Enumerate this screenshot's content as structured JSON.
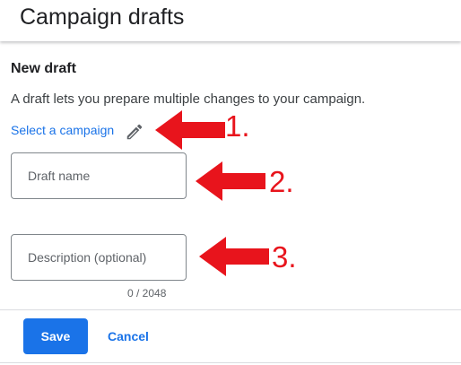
{
  "header": {
    "title": "Campaign drafts"
  },
  "form": {
    "section_title": "New draft",
    "description": "A draft lets you prepare multiple changes to your campaign.",
    "select_campaign_label": "Select a campaign",
    "select_campaign_icon": "pencil-icon",
    "draft_name_placeholder": "Draft name",
    "draft_name_value": "",
    "description_placeholder": "Description (optional)",
    "description_value": "",
    "char_counter": "0 / 2048"
  },
  "actions": {
    "save_label": "Save",
    "cancel_label": "Cancel"
  },
  "annotations": {
    "color": "#e8141c",
    "labels": [
      "1.",
      "2.",
      "3."
    ]
  },
  "colors": {
    "accent": "#1a73e8",
    "annotation": "#e8141c"
  }
}
